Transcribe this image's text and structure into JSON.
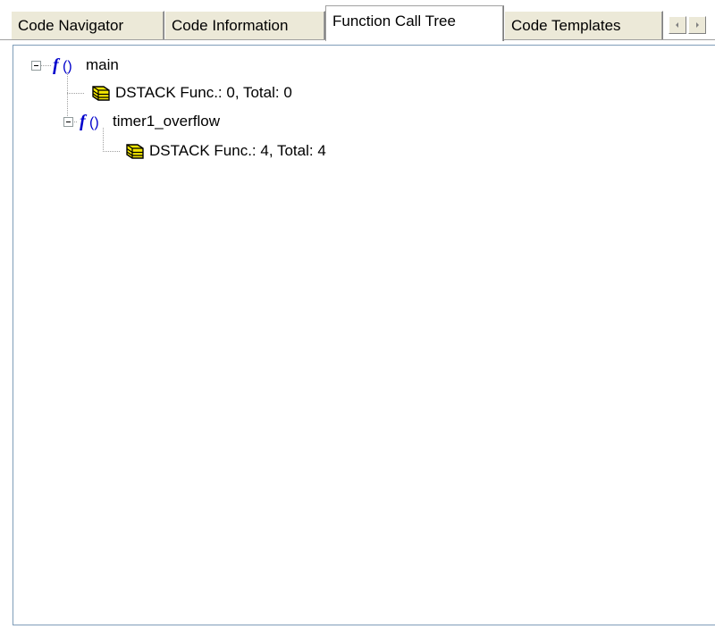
{
  "tabs": [
    {
      "label": "Code Navigator",
      "active": false
    },
    {
      "label": "Code Information",
      "active": false
    },
    {
      "label": "Function Call Tree",
      "active": true
    },
    {
      "label": "Code Templates",
      "active": false
    }
  ],
  "tab_scroll": {
    "left_icon": "arrow-left-icon",
    "right_icon": "arrow-right-icon"
  },
  "tree": {
    "main": {
      "label": "main",
      "icon": "function-icon",
      "expanded": true
    },
    "main_dstack": {
      "label": "DSTACK Func.: 0, Total: 0",
      "icon": "database-icon"
    },
    "timer": {
      "label": "timer1_overflow",
      "icon": "function-icon",
      "expanded": true
    },
    "timer_dstack": {
      "label": "DSTACK Func.: 4, Total: 4",
      "icon": "database-icon"
    }
  },
  "colors": {
    "function_icon": "#0000cc",
    "database_icon": "#f5e800",
    "tree_lines": "#a0a0a0"
  }
}
